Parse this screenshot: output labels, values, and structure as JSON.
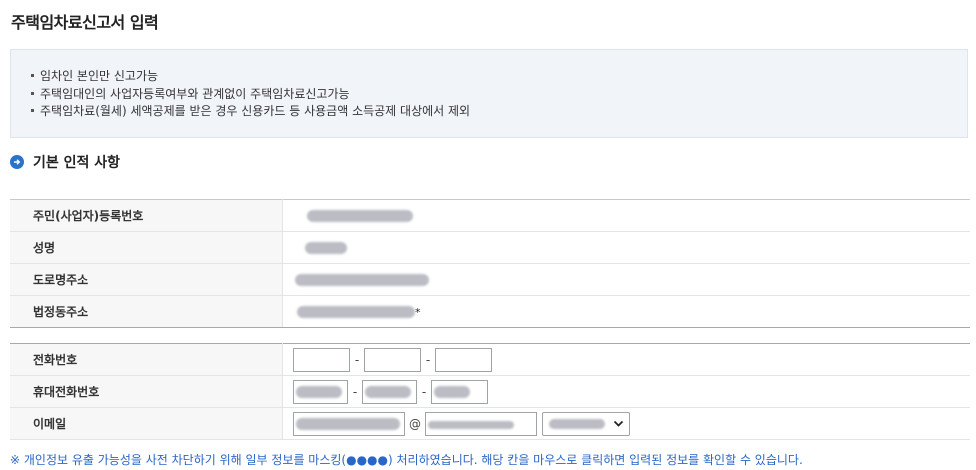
{
  "page": {
    "title": "주택임차료신고서 입력"
  },
  "notice": {
    "items": [
      "임차인 본인만 신고가능",
      "주택임대인의 사업자등록여부와 관계없이 주택임차료신고가능",
      "주택임차료(월세) 세액공제를 받은 경우 신용카드 등 사용금액 소득공제 대상에서 제외"
    ]
  },
  "section": {
    "title": "기본 인적 사항",
    "icon": "arrow-right-circle-icon"
  },
  "basic_info": {
    "rows": [
      {
        "label": "주민(사업자)등록번호",
        "value_masked": true
      },
      {
        "label": "성명",
        "value_masked": true
      },
      {
        "label": "도로명주소",
        "value_masked": true
      },
      {
        "label": "법정동주소",
        "value_masked": true,
        "suffix": "*"
      }
    ]
  },
  "contact": {
    "phone_label": "전화번호",
    "mobile_label": "휴대전화번호",
    "email_label": "이메일",
    "separator": "-",
    "at": "@"
  },
  "footnote": "※ 개인정보 유출 가능성을 사전 차단하기 위해 일부 정보를 마스킹(●●●●) 처리하였습니다. 해당 칸을 마우스로 클릭하면 입력된 정보를 확인할 수 있습니다.",
  "colors": {
    "accent": "#2a73c9",
    "notice_bg": "#f1f5fa",
    "footnote": "#2a66c8",
    "label_bg": "#f7f7f7"
  }
}
